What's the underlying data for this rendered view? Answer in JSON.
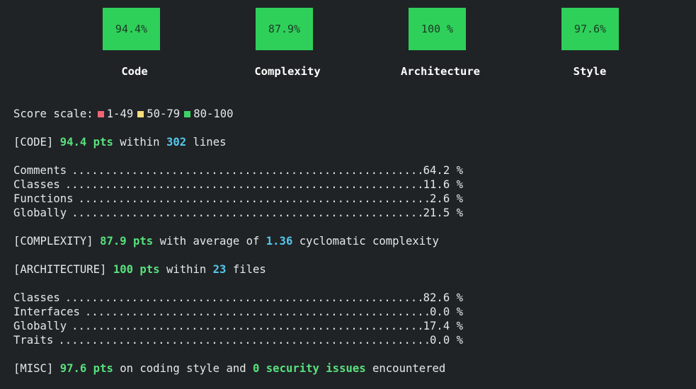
{
  "summary": [
    {
      "value": "94.4%",
      "label": "Code"
    },
    {
      "value": "87.9%",
      "label": "Complexity"
    },
    {
      "value": "100 %",
      "label": "Architecture"
    },
    {
      "value": "97.6%",
      "label": "Style"
    }
  ],
  "scale": {
    "title": "Score scale:",
    "ranges": [
      {
        "text": "1-49",
        "color": "#f06474"
      },
      {
        "text": "50-79",
        "color": "#f6dc7c"
      },
      {
        "text": "80-100",
        "color": "#3dd466"
      }
    ]
  },
  "code": {
    "tag": "[CODE]",
    "pts": "94.4 pts",
    "within": "within",
    "lines_count": "302",
    "lines_word": "lines",
    "rows": [
      {
        "name": "Comments",
        "value": "64.2 %"
      },
      {
        "name": "Classes",
        "value": "11.6 %"
      },
      {
        "name": "Functions",
        "value": "2.6 %"
      },
      {
        "name": "Globally",
        "value": "21.5 %"
      }
    ]
  },
  "complexity": {
    "tag": "[COMPLEXITY]",
    "pts": "87.9 pts",
    "text1": "with average of",
    "avg": "1.36",
    "text2": "cyclomatic complexity"
  },
  "architecture": {
    "tag": "[ARCHITECTURE]",
    "pts": "100 pts",
    "within": "within",
    "files_count": "23",
    "files_word": "files",
    "rows": [
      {
        "name": "Classes",
        "value": "82.6 %"
      },
      {
        "name": "Interfaces",
        "value": "0.0 %"
      },
      {
        "name": "Globally",
        "value": "17.4 %"
      },
      {
        "name": "Traits",
        "value": "0.0 %"
      }
    ]
  },
  "misc": {
    "tag": "[MISC]",
    "pts": "97.6 pts",
    "text1": "on coding style and",
    "issues": "0 security issues",
    "text2": "encountered"
  },
  "colors": {
    "background": "#1f2326",
    "badge": "#2fd05a",
    "highlight_green": "#59e07c",
    "highlight_cyan": "#55c7ea"
  }
}
